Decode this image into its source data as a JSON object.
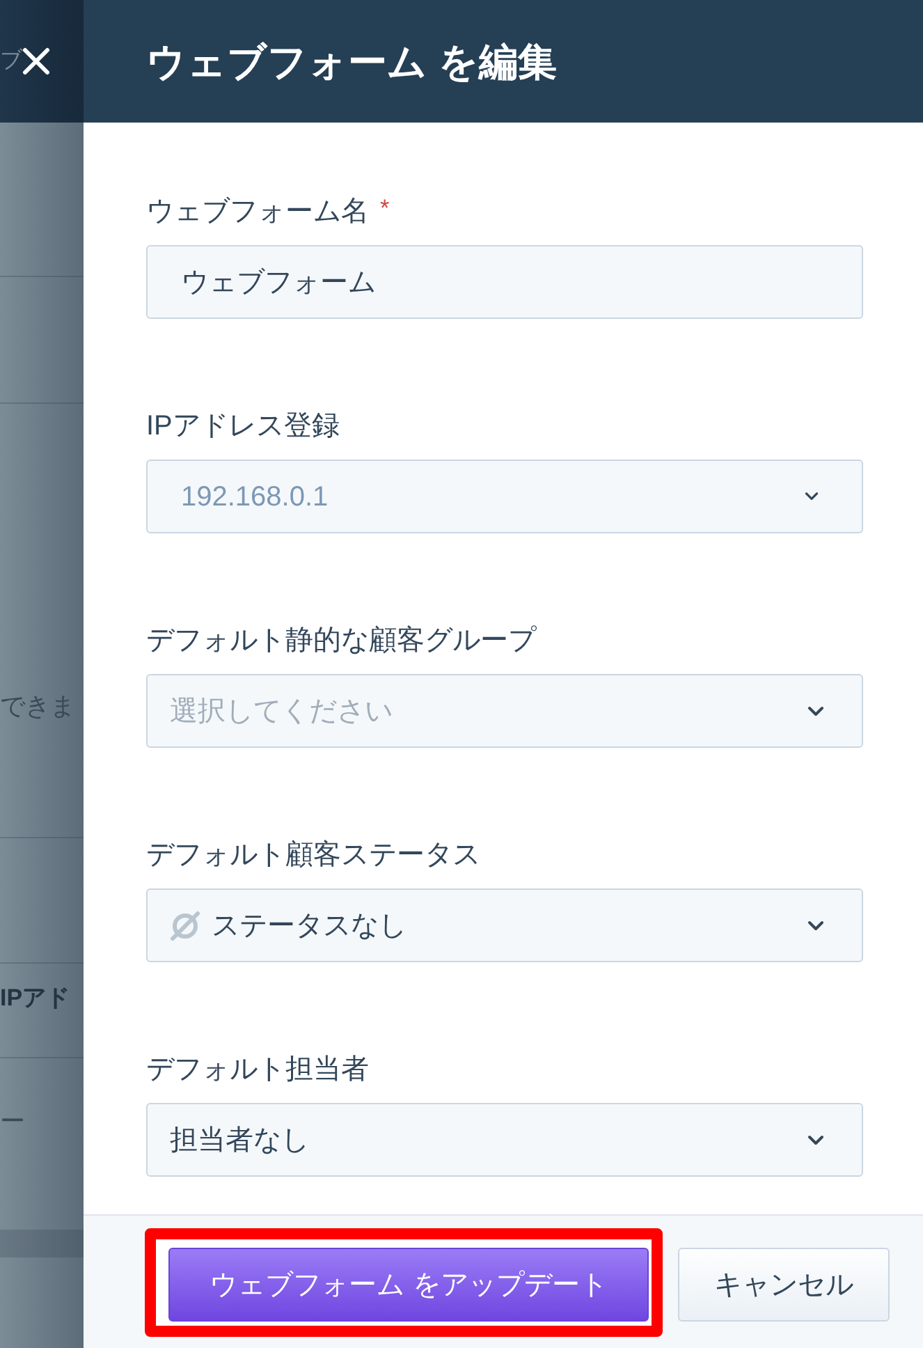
{
  "background_page": {
    "header_text": "ブ",
    "texts": [
      {
        "kind": "note",
        "text": "できま"
      },
      {
        "kind": "column-header",
        "text": "IPアド"
      },
      {
        "kind": "cell",
        "text": "ー"
      }
    ]
  },
  "drawer": {
    "title": "ウェブフォーム を編集"
  },
  "fields": [
    {
      "kind": "text",
      "label": "ウェブフォーム名",
      "required_mark": "*",
      "value": "ウェブフォーム"
    },
    {
      "kind": "ip-select",
      "label": "IPアドレス登録",
      "value": "192.168.0.1"
    },
    {
      "kind": "select",
      "label": "デフォルト静的な顧客グループ",
      "placeholder": "選択してください"
    },
    {
      "kind": "status-select",
      "label": "デフォルト顧客ステータス",
      "value": "ステータスなし"
    },
    {
      "kind": "select",
      "label": "デフォルト担当者",
      "value": "担当者なし"
    }
  ],
  "footer": {
    "buttons": [
      {
        "kind": "primary",
        "label": "ウェブフォーム をアップデート",
        "highlighted": true
      },
      {
        "kind": "secondary",
        "label": "キャンセル",
        "highlighted": false
      }
    ]
  }
}
